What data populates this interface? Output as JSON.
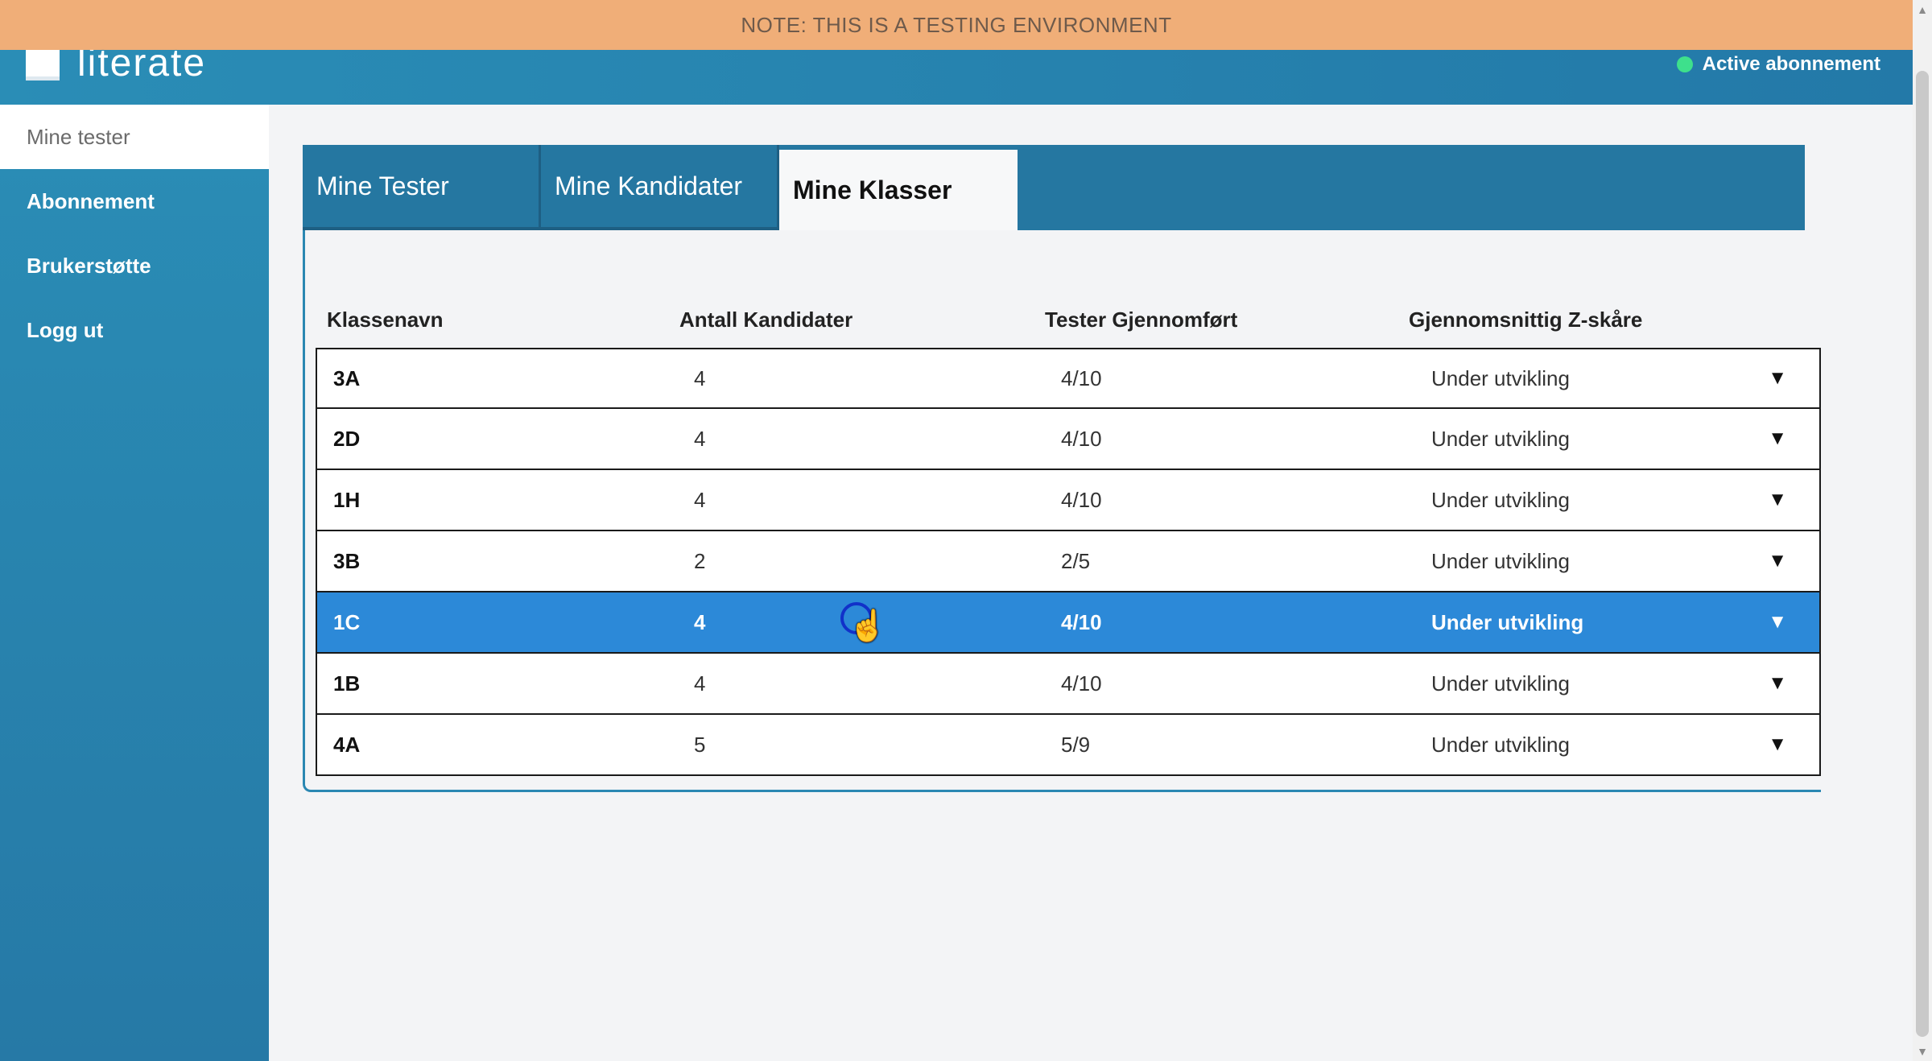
{
  "banner": {
    "text": "NOTE: THIS IS A TESTING ENVIRONMENT"
  },
  "header": {
    "logo_text": "literate",
    "subscription_status": "Active abonnement",
    "status_color": "#3ee08c"
  },
  "sidebar": {
    "items": [
      {
        "label": "Mine tester",
        "active": true
      },
      {
        "label": "Abonnement",
        "active": false
      },
      {
        "label": "Brukerstøtte",
        "active": false
      },
      {
        "label": "Logg ut",
        "active": false
      }
    ]
  },
  "tabs": [
    {
      "label": "Mine Tester",
      "active": false
    },
    {
      "label": "Mine Kandidater",
      "active": false
    },
    {
      "label": "Mine Klasser",
      "active": true
    }
  ],
  "table": {
    "headers": [
      "Klassenavn",
      "Antall Kandidater",
      "Tester Gjennomført",
      "Gjennomsnittig Z-skåre"
    ],
    "rows": [
      {
        "name": "3A",
        "count": "4",
        "tests": "4/10",
        "score": "Under utvikling",
        "selected": false
      },
      {
        "name": "2D",
        "count": "4",
        "tests": "4/10",
        "score": "Under utvikling",
        "selected": false
      },
      {
        "name": "1H",
        "count": "4",
        "tests": "4/10",
        "score": "Under utvikling",
        "selected": false
      },
      {
        "name": "3B",
        "count": "2",
        "tests": "2/5",
        "score": "Under utvikling",
        "selected": false
      },
      {
        "name": "1C",
        "count": "4",
        "tests": "4/10",
        "score": "Under utvikling",
        "selected": true
      },
      {
        "name": "1B",
        "count": "4",
        "tests": "4/10",
        "score": "Under utvikling",
        "selected": false
      },
      {
        "name": "4A",
        "count": "5",
        "tests": "5/9",
        "score": "Under utvikling",
        "selected": false
      }
    ],
    "expand_icon": "caret-down-icon"
  },
  "colors": {
    "banner": "#f0ae78",
    "primary": "#2a8db6",
    "selected_row": "#2c89d8"
  }
}
